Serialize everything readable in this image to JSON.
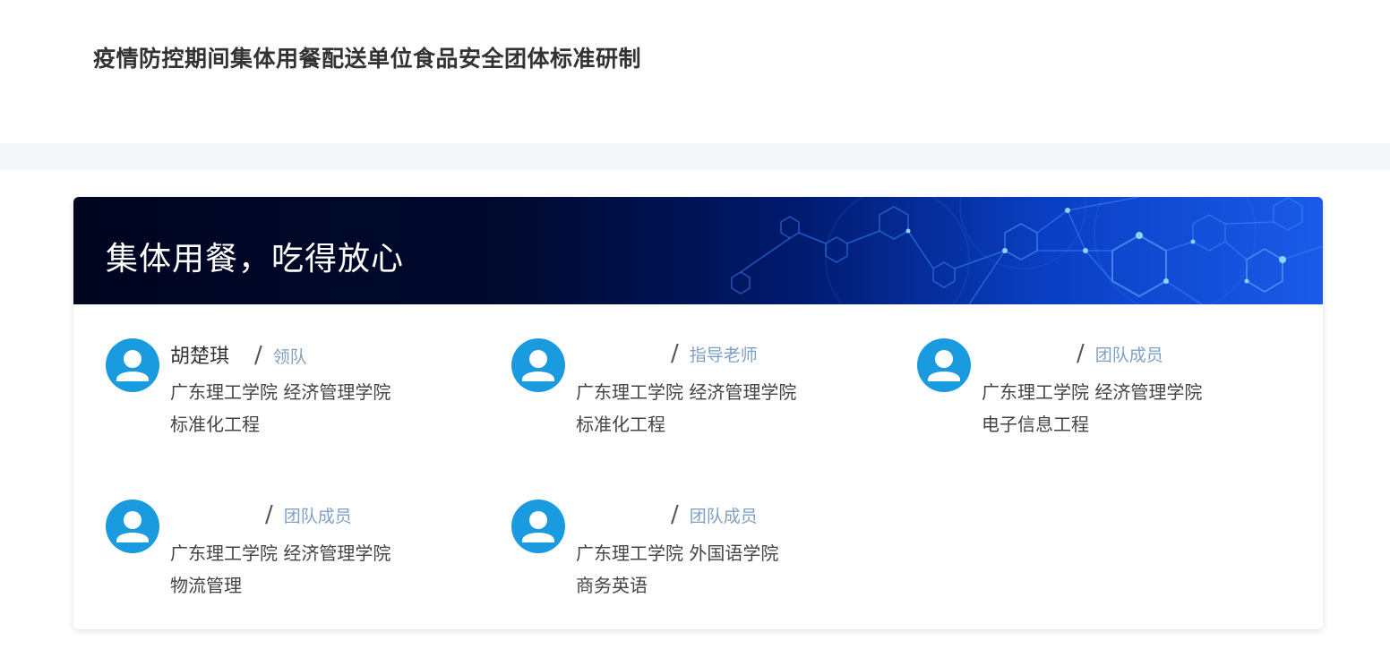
{
  "header": {
    "title": "疫情防控期间集体用餐配送单位食品安全团体标准研制"
  },
  "banner": {
    "title": "集体用餐，吃得放心"
  },
  "members": [
    {
      "name": "胡楚琪",
      "role": "领队",
      "school": "广东理工学院 经济管理学院",
      "major": "标准化工程"
    },
    {
      "name": "",
      "role": "指导老师",
      "school": "广东理工学院 经济管理学院",
      "major": "标准化工程"
    },
    {
      "name": "",
      "role": "团队成员",
      "school": "广东理工学院 经济管理学院",
      "major": "电子信息工程"
    },
    {
      "name": "",
      "role": "团队成员",
      "school": "广东理工学院 经济管理学院",
      "major": "物流管理"
    },
    {
      "name": "",
      "role": "团队成员",
      "school": "广东理工学院 外国语学院",
      "major": "商务英语"
    }
  ],
  "separator": "/",
  "icons": {
    "avatar": "user-avatar-icon"
  },
  "colors": {
    "avatar_blue": "#1a9be0",
    "role_text": "#7fa0c4",
    "banner_dark": "#000520",
    "banner_light": "#1b5be8"
  }
}
